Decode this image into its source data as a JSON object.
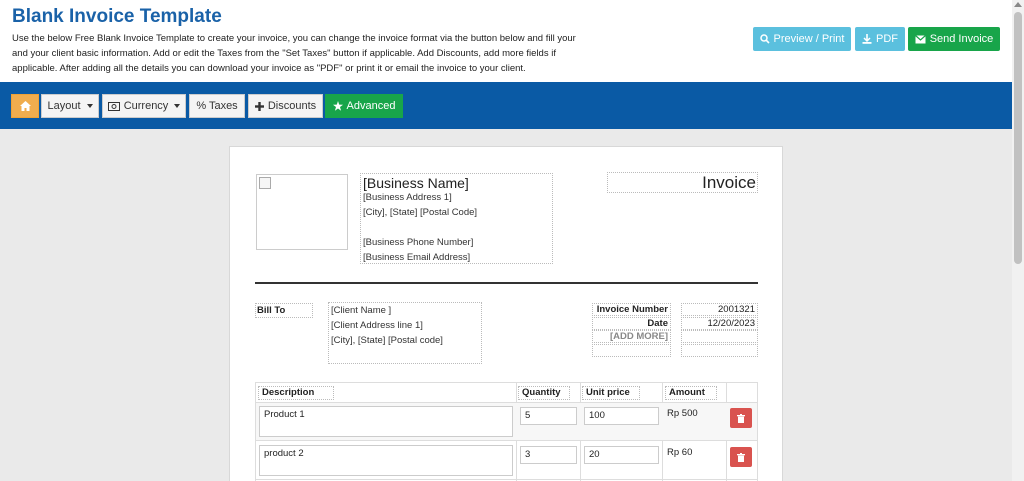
{
  "header": {
    "title": "Blank Invoice Template",
    "description": "Use the below Free Blank Invoice Template to create your invoice, you can change the invoice format via the button below and fill your and your client basic information. Add or edit the Taxes from the \"Set Taxes\" button if applicable. Add Discounts, add more fields if applicable. After adding all the details you can download your invoice as \"PDF\" or print it or email the invoice to your client.",
    "buttons": {
      "preview": "Preview / Print",
      "pdf": "PDF",
      "send": "Send Invoice"
    }
  },
  "toolbar": {
    "layout": "Layout",
    "currency": "Currency",
    "taxes": "% Taxes",
    "discounts": "Discounts",
    "advanced": "Advanced"
  },
  "invoice": {
    "title": "Invoice",
    "business": {
      "name": "[Business Name]",
      "address1": "[Business Address 1]",
      "city": "[City], [State] [Postal Code]",
      "phone": "[Business Phone Number]",
      "email": "[Business Email Address]"
    },
    "bill_to_label": "Bill To",
    "client": {
      "name": "[Client Name ]",
      "address1": "[Client Address line 1]",
      "city": "[City], [State] [Postal code]"
    },
    "meta": {
      "invoice_number_label": "Invoice Number",
      "invoice_number": "2001321",
      "date_label": "Date",
      "date": "12/20/2023",
      "add_more": "[ADD MORE]"
    },
    "table": {
      "headers": {
        "description": "Description",
        "quantity": "Quantity",
        "unit_price": "Unit price",
        "amount": "Amount"
      },
      "rows": [
        {
          "description": "Product 1",
          "quantity": "5",
          "unit_price": "100",
          "amount": "Rp 500"
        },
        {
          "description": "product 2",
          "quantity": "3",
          "unit_price": "20",
          "amount": "Rp 60"
        }
      ]
    }
  },
  "colors": {
    "title_blue": "#1a62a8",
    "toolbar_blue": "#0a5aa5",
    "info_button": "#5bc0de",
    "success_button": "#18a54a",
    "home_button": "#f0ad4e",
    "delete_button": "#d9534f"
  },
  "icons": {
    "preview": "search-icon",
    "pdf": "download-icon",
    "send": "envelope-icon",
    "home": "home-icon",
    "currency": "money-icon",
    "discounts": "plus-icon",
    "advanced": "star-icon",
    "delete": "trash-icon"
  }
}
